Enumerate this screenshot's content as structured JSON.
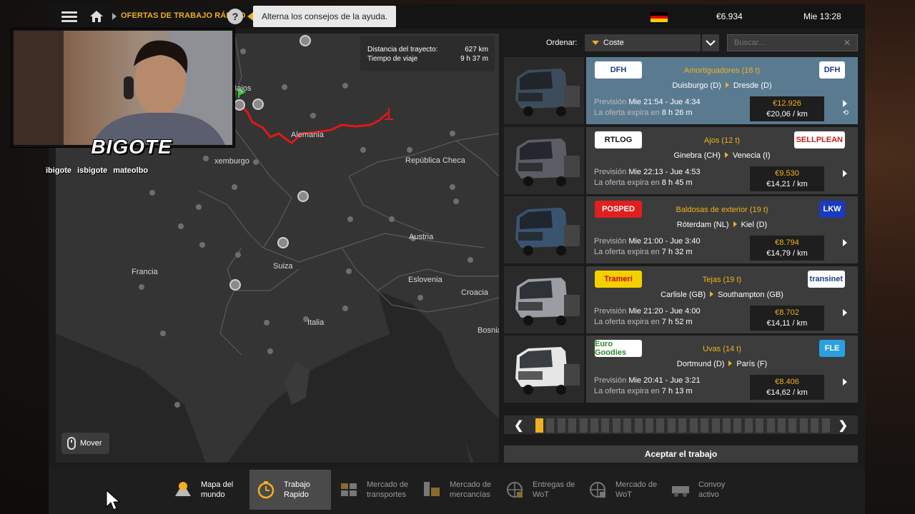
{
  "topbar": {
    "breadcrumb": "OFERTAS DE TRABAJO RÁPIDO",
    "help_icon": "?",
    "tooltip": "Alterna los consejos de la ayuda.",
    "money": "€6.934",
    "time": "Mie 13:28",
    "flag_colors": [
      "#000000",
      "#dd0000",
      "#ffce00"
    ]
  },
  "overlay": {
    "title": "BIGOTE",
    "socials": [
      "ibigote",
      "isbigote",
      "mateolbo"
    ]
  },
  "map": {
    "route_info": {
      "distance_label": "Distancia del trayecto:",
      "distance_value": "627 km",
      "time_label": "Tiempo de viaje",
      "time_value": "9 h 37 m"
    },
    "labels": [
      "Bajos",
      "Alemania",
      "xemburgo",
      "República Checa",
      "Austria",
      "Francia",
      "Suiza",
      "Eslovenia",
      "Croacia",
      "Italia",
      "Bosnia"
    ],
    "mover": "Mover",
    "route_color": "#e01818"
  },
  "list": {
    "sort_label": "Ordenar:",
    "sort_value": "Coste",
    "search_placeholder": "Buscar...",
    "jobs": [
      {
        "logo_left": "DFH",
        "logo_right": "DFH",
        "cargo": "Amortiguadores (18 t)",
        "from": "Duisburgo (D)",
        "to": "Dresde (D)",
        "prev_label": "Previsión",
        "prev_value": "Mie 21:54 - Jue 4:34",
        "exp_label": "La oferta expira en",
        "exp_value": "8 h 26 m",
        "price": "€12.926",
        "per_km": "€20,06 / km"
      },
      {
        "logo_left": "RTLOG",
        "logo_right": "SELLPLEAN",
        "cargo": "Ajos (12 t)",
        "from": "Ginebra (CH)",
        "to": "Venecia (I)",
        "prev_label": "Previsión",
        "prev_value": "Mie 22:13 - Jue 4:53",
        "exp_label": "La oferta expira en",
        "exp_value": "8 h 45 m",
        "price": "€9.530",
        "per_km": "€14,21 / km"
      },
      {
        "logo_left": "POSPED",
        "logo_right": "LKW",
        "cargo": "Baldosas de exterior (19 t)",
        "from": "Róterdam (NL)",
        "to": "Kiel (D)",
        "prev_label": "Previsión",
        "prev_value": "Mie 21:00 - Jue 3:40",
        "exp_label": "La oferta expira en",
        "exp_value": "7 h 32 m",
        "price": "€8.794",
        "per_km": "€14,79 / km"
      },
      {
        "logo_left": "Trameri",
        "logo_right": "transinet",
        "cargo": "Tejas (19 t)",
        "from": "Carlisle (GB)",
        "to": "Southampton (GB)",
        "prev_label": "Previsión",
        "prev_value": "Mie 21:20 - Jue 4:00",
        "exp_label": "La oferta expira en",
        "exp_value": "7 h 52 m",
        "price": "€8.702",
        "per_km": "€14,11 / km"
      },
      {
        "logo_left": "Euro Goodies",
        "logo_right": "FLE",
        "cargo": "Uvas (14 t)",
        "from": "Dortmund (D)",
        "to": "París (F)",
        "prev_label": "Previsión",
        "prev_value": "Mie 20:41 - Jue 3:21",
        "exp_label": "La oferta expira en",
        "exp_value": "7 h 13 m",
        "price": "€8.406",
        "per_km": "€14,62 / km"
      }
    ],
    "pages_total": 27,
    "page_current": 1,
    "accept_label": "Aceptar el trabajo"
  },
  "bottom_nav": [
    {
      "label": "Mapa del mundo",
      "icon": "world-map-icon"
    },
    {
      "label": "Trabajo Rapido",
      "icon": "stopwatch-icon",
      "active": true
    },
    {
      "label": "Mercado de transportes",
      "icon": "freight-market-icon"
    },
    {
      "label": "Mercado de mercancías",
      "icon": "cargo-market-icon"
    },
    {
      "label": "Entregas de WoT",
      "icon": "globe-delivery-icon"
    },
    {
      "label": "Mercado de WoT",
      "icon": "globe-market-icon"
    },
    {
      "label": "Convoy activo",
      "icon": "convoy-icon"
    }
  ]
}
